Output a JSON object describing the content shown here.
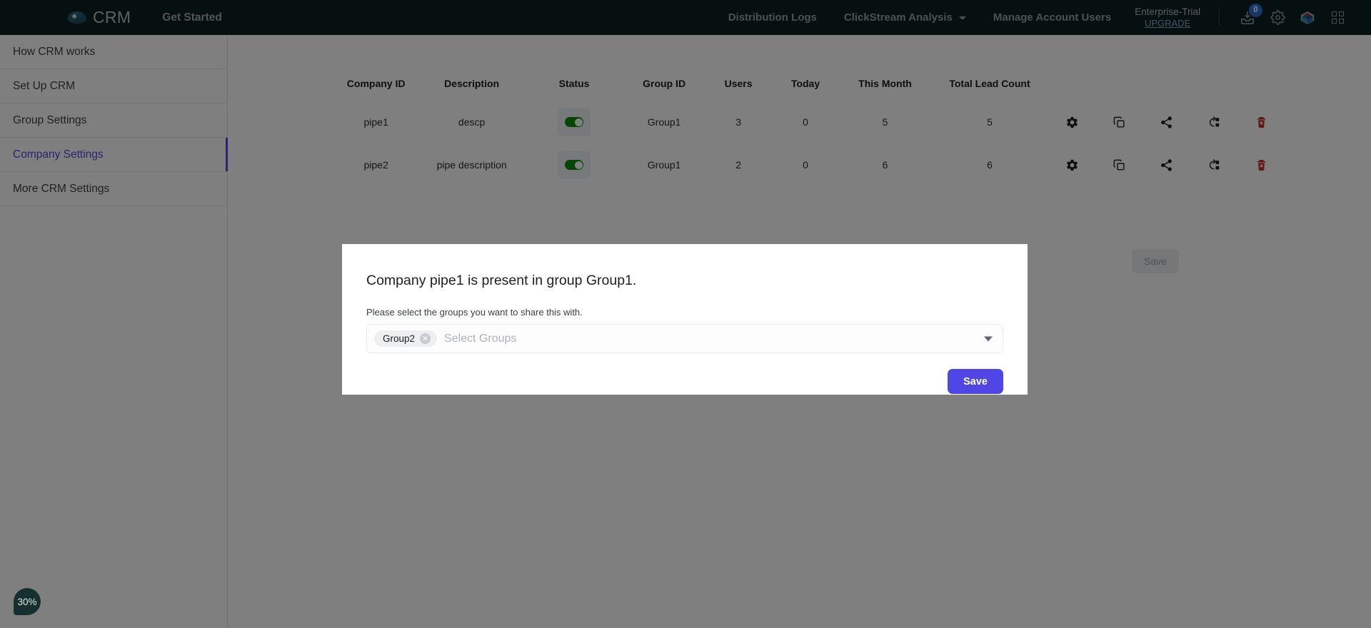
{
  "topnav": {
    "brand": "CRM",
    "get_started": "Get Started",
    "links": [
      {
        "label": "Distribution Logs",
        "dropdown": false
      },
      {
        "label": "ClickStream Analysis",
        "dropdown": true
      },
      {
        "label": "Manage Account Users",
        "dropdown": false
      }
    ],
    "plan_name": "Enterprise-Trial",
    "plan_upgrade": "UPGRADE",
    "inbox_badge": "0",
    "colors": {
      "bar": "#0f2022",
      "badge": "#2f6fd0",
      "link": "#93a6a4"
    }
  },
  "sidebar": {
    "items": [
      {
        "label": "How CRM works",
        "active": false
      },
      {
        "label": "Set Up CRM",
        "active": false
      },
      {
        "label": "Group Settings",
        "active": false
      },
      {
        "label": "Company Settings",
        "active": true
      },
      {
        "label": "More CRM Settings",
        "active": false
      }
    ],
    "active_color": "#4f46e5"
  },
  "table": {
    "headers": [
      "Company ID",
      "Description",
      "Status",
      "Group ID",
      "Users",
      "Today",
      "This Month",
      "Total Lead Count"
    ],
    "rows": [
      {
        "company_id": "pipe1",
        "description": "descp",
        "status_on": true,
        "group_id": "Group1",
        "users": "3",
        "today": "0",
        "this_month": "5",
        "total_lead_count": "5"
      },
      {
        "company_id": "pipe2",
        "description": "pipe description",
        "status_on": true,
        "group_id": "Group1",
        "users": "2",
        "today": "0",
        "this_month": "6",
        "total_lead_count": "6"
      }
    ],
    "row_actions": [
      "gear-icon",
      "copy-icon",
      "share-icon",
      "refresh-box-icon",
      "delete-icon"
    ],
    "save_label": "Save",
    "toggle_on_color": "#0b8a0b",
    "delete_color": "#c62828"
  },
  "modal": {
    "title": "Company pipe1 is present in group Group1.",
    "subtitle": "Please select the groups you want to share this with.",
    "chips": [
      {
        "label": "Group2"
      }
    ],
    "placeholder": "Select Groups",
    "save_label": "Save",
    "save_color": "#4f46e5"
  },
  "zoom_badge": {
    "label": "30%"
  }
}
